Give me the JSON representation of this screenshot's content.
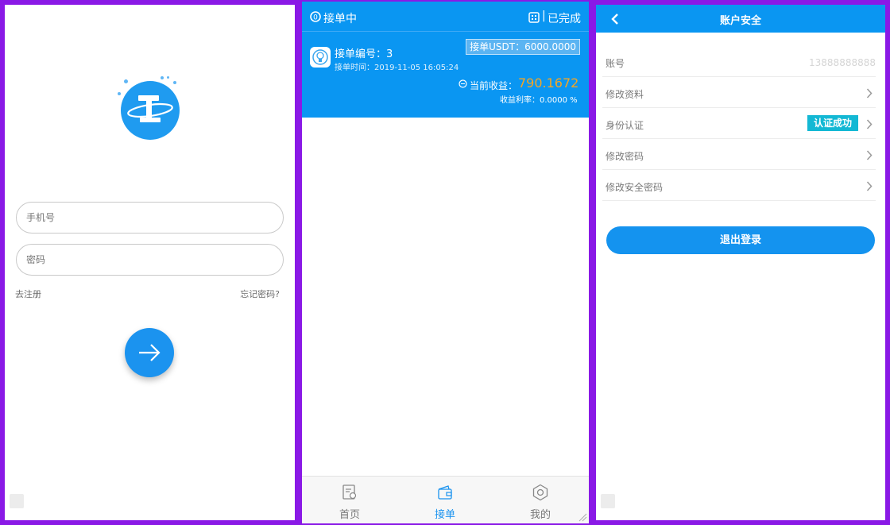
{
  "login": {
    "phone_placeholder": "手机号",
    "password_placeholder": "密码",
    "register_link": "去注册",
    "forgot_link": "忘记密码?",
    "submit_icon": "arrow-right-icon"
  },
  "orders": {
    "tab_active": "接单中",
    "tab_done": "已完成",
    "order": {
      "number_label": "接单编号：3",
      "time_label": "接单时间：2019-11-05 16:05:24",
      "amount_label": "接单USDT：6000.0000",
      "earnings_label": "当前收益：",
      "earnings_value": "790.1672",
      "rate_label": "收益利率：0.0000 %"
    },
    "nav": [
      {
        "label": "首页",
        "icon": "home-doc-icon"
      },
      {
        "label": "接单",
        "icon": "wallet-icon"
      },
      {
        "label": "我的",
        "icon": "hexagon-icon"
      }
    ],
    "colors": {
      "accent": "#0a96f2",
      "earnings": "#f5a623"
    }
  },
  "security": {
    "title": "账户安全",
    "rows": [
      {
        "label": "账号",
        "value": "13888888888"
      },
      {
        "label": "修改资料"
      },
      {
        "label": "身份认证",
        "badge": "认证成功"
      },
      {
        "label": "修改密码"
      },
      {
        "label": "修改安全密码"
      }
    ],
    "logout": "退出登录"
  }
}
